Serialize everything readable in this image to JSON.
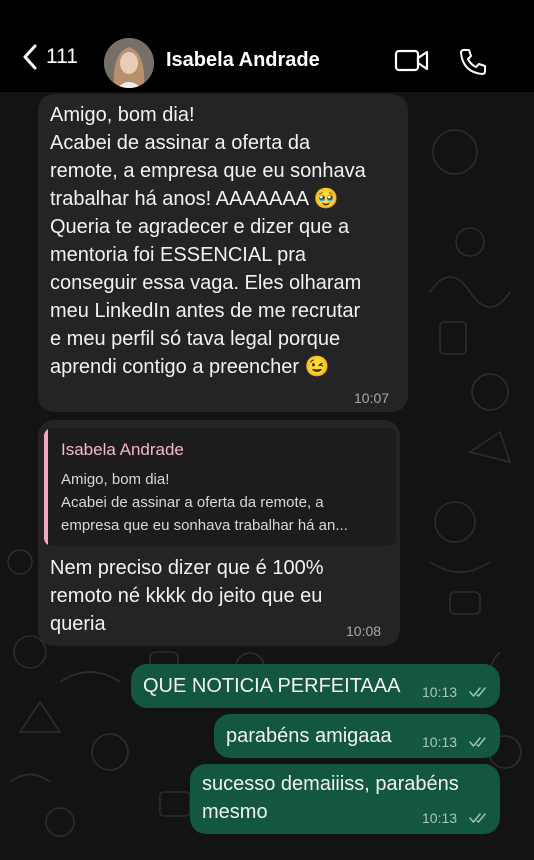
{
  "header": {
    "back_count": "111",
    "contact_name": "Isabela Andrade",
    "video_icon": "video-camera-icon",
    "call_icon": "phone-icon"
  },
  "colors": {
    "incoming_bubble": "#242424",
    "outgoing_bubble": "#12573e",
    "quote_accent": "#f3a6c6"
  },
  "messages": [
    {
      "direction": "incoming",
      "text": "Amigo, bom dia!\nAcabei de assinar a oferta da\nremote, a empresa que eu sonhava\ntrabalhar há anos! AAAAAAA 🥹\nQueria te agradecer e dizer que a\nmentoria foi ESSENCIAL pra\nconseguir essa vaga. Eles olharam\nmeu LinkedIn antes de me recrutar\ne meu perfil só tava legal porque\naprendi contigo a preencher 😉",
      "time": "10:07"
    },
    {
      "direction": "incoming",
      "quote": {
        "author": "Isabela Andrade",
        "line1": "Amigo, bom dia!",
        "line2": "Acabei de assinar a oferta da remote, a",
        "line3": "empresa que eu sonhava trabalhar há an..."
      },
      "text": "Nem preciso dizer que é 100%\nremoto né kkkk do jeito que eu\nqueria",
      "time": "10:08"
    },
    {
      "direction": "outgoing",
      "text": "QUE NOTICIA PERFEITAAA",
      "time": "10:13",
      "status": "read"
    },
    {
      "direction": "outgoing",
      "text": "parabéns amigaaa",
      "time": "10:13",
      "status": "read"
    },
    {
      "direction": "outgoing",
      "text": "sucesso demaiiiss, parabéns\nmesmo",
      "time": "10:13",
      "status": "read"
    }
  ]
}
